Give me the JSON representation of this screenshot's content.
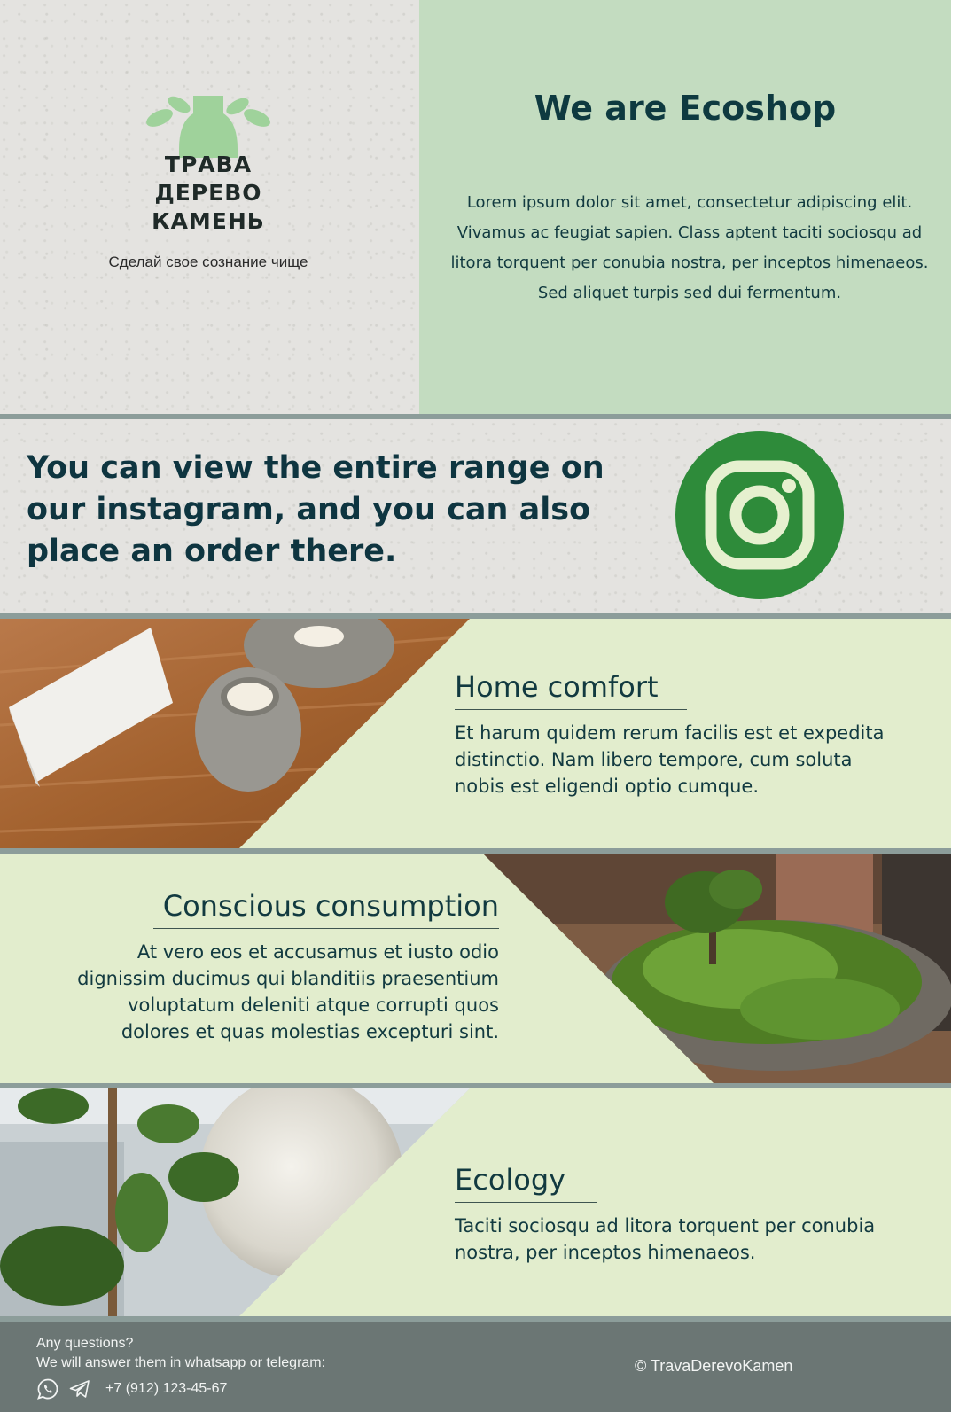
{
  "colors": {
    "dark_teal": "#0e3a40",
    "mint": "#c3dcc0",
    "pale_green": "#e2edcd",
    "instagram_green": "#2e8b3a",
    "footer_grey": "#6b7674",
    "divider": "#8c9d9a"
  },
  "brand": {
    "logo_lines": [
      "ТРАВА",
      "ДЕРЕВО",
      "КАМЕНЬ"
    ],
    "tagline": "Сделай свое сознание чище"
  },
  "intro": {
    "title": "We are Ecoshop",
    "text": "Lorem ipsum dolor sit amet, consectetur adipiscing elit. Vivamus ac feugiat sapien. Class aptent taciti sociosqu ad litora torquent per conubia nostra, per inceptos himenaeos. Sed aliquet turpis sed dui fermentum."
  },
  "instagram": {
    "text": "You can view the entire range on our instagram, and you can also place an order there.",
    "icon": "instagram-icon"
  },
  "features": [
    {
      "title": "Home comfort",
      "text": "Et harum quidem rerum facilis est et expedita distinctio. Nam libero tempore, cum soluta nobis est eligendi optio cumque.",
      "photo": "stone-candle-holders-photo"
    },
    {
      "title": "Conscious consumption",
      "text": "At vero eos et accusamus et iusto odio dignissim ducimus qui blanditiis praesentium voluptatum deleniti atque corrupti quos dolores et quas molestias excepturi sint.",
      "photo": "moss-bonsai-planter-photo"
    },
    {
      "title": "Ecology",
      "text": "Taciti sociosqu ad litora torquent per conubia nostra, per inceptos himenaeos.",
      "photo": "fig-plant-moon-lamp-photo"
    }
  ],
  "footer": {
    "question": "Any questions?",
    "answer": "We will answer them in whatsapp or telegram:",
    "phone": "+7 (912) 123-45-67",
    "copyright": "© TravaDerevoKamen",
    "icons": [
      "whatsapp-icon",
      "telegram-icon"
    ]
  }
}
